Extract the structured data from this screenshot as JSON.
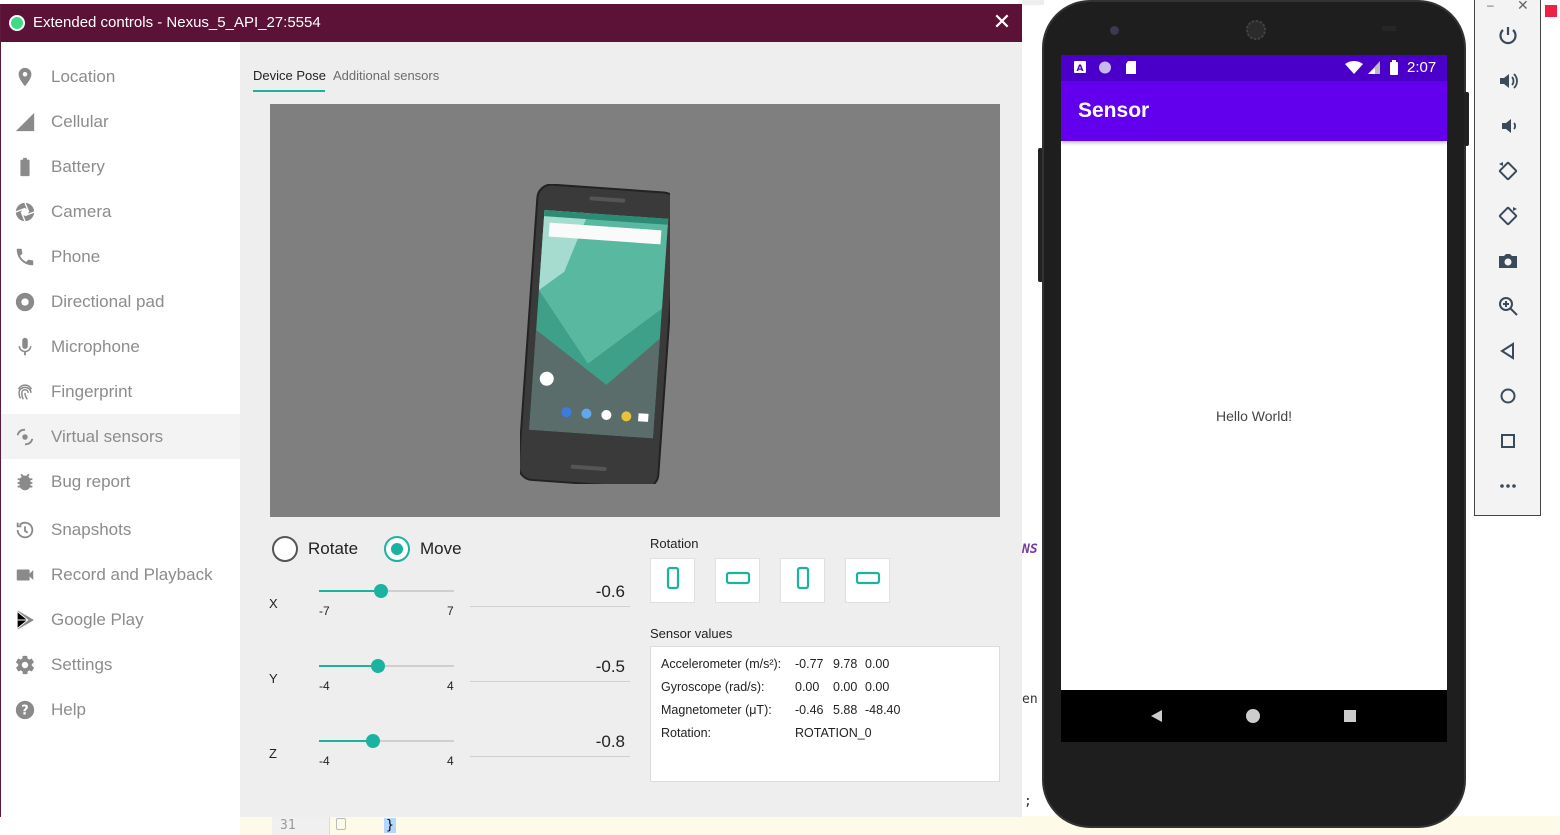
{
  "window": {
    "title": "Extended controls - Nexus_5_API_27:5554",
    "close_glyph": "✕"
  },
  "sidebar": {
    "items": [
      {
        "label": "Location",
        "icon": "location-pin-icon"
      },
      {
        "label": "Cellular",
        "icon": "cellular-signal-icon"
      },
      {
        "label": "Battery",
        "icon": "battery-icon"
      },
      {
        "label": "Camera",
        "icon": "camera-aperture-icon"
      },
      {
        "label": "Phone",
        "icon": "phone-icon"
      },
      {
        "label": "Directional pad",
        "icon": "dpad-icon"
      },
      {
        "label": "Microphone",
        "icon": "microphone-icon"
      },
      {
        "label": "Fingerprint",
        "icon": "fingerprint-icon"
      },
      {
        "label": "Virtual sensors",
        "icon": "virtual-sensors-icon",
        "active": true
      },
      {
        "label": "Bug report",
        "icon": "bug-icon"
      },
      {
        "label": "Snapshots",
        "icon": "history-icon"
      },
      {
        "label": "Record and Playback",
        "icon": "video-camera-icon"
      },
      {
        "label": "Google Play",
        "icon": "play-store-icon"
      },
      {
        "label": "Settings",
        "icon": "gear-icon"
      },
      {
        "label": "Help",
        "icon": "help-icon"
      }
    ]
  },
  "tabs": [
    {
      "label": "Device Pose",
      "active": true
    },
    {
      "label": "Additional sensors",
      "active": false
    }
  ],
  "mode": {
    "rotate_label": "Rotate",
    "move_label": "Move",
    "selected": "Move"
  },
  "axes": [
    {
      "name": "X",
      "min_label": "-7",
      "max_label": "7",
      "min": -7,
      "max": 7,
      "value": -0.6,
      "value_text": "-0.6"
    },
    {
      "name": "Y",
      "min_label": "-4",
      "max_label": "4",
      "min": -4,
      "max": 4,
      "value": -0.5,
      "value_text": "-0.5"
    },
    {
      "name": "Z",
      "min_label": "-4",
      "max_label": "4",
      "min": -4,
      "max": 4,
      "value": -0.8,
      "value_text": "-0.8"
    }
  ],
  "rotation": {
    "label": "Rotation",
    "buttons": [
      "portrait",
      "landscape",
      "reverse-portrait",
      "reverse-landscape"
    ]
  },
  "sensor_values": {
    "label": "Sensor values",
    "rows": [
      {
        "name": "Accelerometer (m/s²):",
        "values": [
          "-0.77",
          "9.78",
          "0.00"
        ]
      },
      {
        "name": "Gyroscope (rad/s):",
        "values": [
          "0.00",
          "0.00",
          "0.00"
        ]
      },
      {
        "name": "Magnetometer (μT):",
        "values": [
          "-0.46",
          "5.88",
          "-48.40"
        ]
      },
      {
        "name": "Rotation:",
        "values": [
          "ROTATION_0"
        ]
      }
    ]
  },
  "emulator": {
    "status_time": "2:07",
    "app_title": "Sensor",
    "body_text": "Hello World!",
    "colors": {
      "status_bar": "#4b00c9",
      "app_bar": "#6200ee"
    }
  },
  "toolbar": {
    "minimize_glyph": "–",
    "close_glyph": "✕",
    "buttons": [
      "power-icon",
      "volume-up-icon",
      "volume-down-icon",
      "rotate-left-icon",
      "rotate-right-icon",
      "screenshot-camera-icon",
      "zoom-icon",
      "back-icon",
      "home-icon",
      "overview-icon",
      "more-icon"
    ]
  },
  "ide": {
    "line_number": "31",
    "brace": "}",
    "fragment_ns": "NS",
    "fragment_en": "en",
    "fragment_semicolon": ";"
  },
  "colors": {
    "accent": "#1ab3a0",
    "titlebar": "#5b1236"
  }
}
